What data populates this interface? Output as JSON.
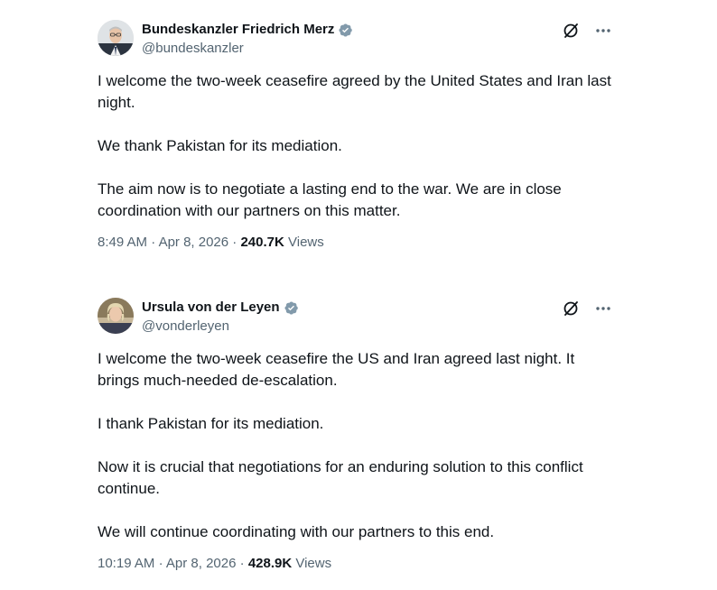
{
  "tweets": [
    {
      "display_name": "Bundeskanzler Friedrich Merz",
      "handle": "@bundeskanzler",
      "verified": true,
      "paragraphs": [
        "I welcome the two-week ceasefire agreed by the United States and Iran last night.",
        "We thank Pakistan for its mediation.",
        "The aim now is to negotiate a lasting end to the war. We are in close coordination with our partners on this matter."
      ],
      "time": "8:49 AM",
      "date": "Apr 8, 2026",
      "views_count": "240.7K",
      "views_label": "Views",
      "separator": "·"
    },
    {
      "display_name": "Ursula von der Leyen",
      "handle": "@vonderleyen",
      "verified": true,
      "paragraphs": [
        "I welcome the two-week ceasefire the US and Iran agreed last night. It brings much-needed de-escalation.",
        "I thank Pakistan for its mediation.",
        "Now it is crucial that negotiations for an enduring solution to this conflict continue.",
        "We will continue coordinating with our partners to this end."
      ],
      "time": "10:19 AM",
      "date": "Apr 8, 2026",
      "views_count": "428.9K",
      "views_label": "Views",
      "separator": "·"
    }
  ],
  "colors": {
    "text_primary": "#0f1419",
    "text_secondary": "#536471",
    "verified_badge": "#829aab"
  },
  "icons": {
    "verified": "verified-badge-icon",
    "grok": "grok-icon",
    "more": "more-icon"
  }
}
